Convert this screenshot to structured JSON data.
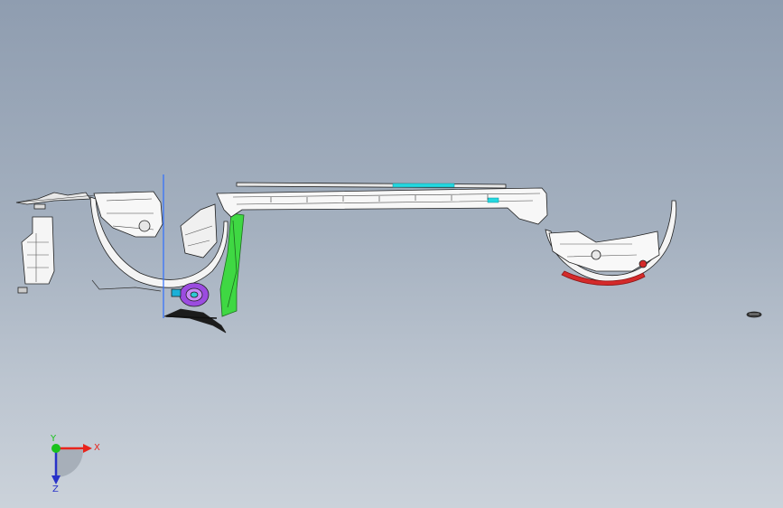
{
  "triad": {
    "x_label": "X",
    "y_label": "Y",
    "z_label": "Z",
    "x_color": "#e8241c",
    "y_color": "#19c21c",
    "z_color": "#2832c8"
  },
  "model": {
    "icon": "car-body-underbody-assembly",
    "accent_colors": {
      "cyan_trim": "#24d8e0",
      "green_pillar": "#35d23a",
      "purple_hub": "#8a3ccf",
      "red_liner": "#d42a2a",
      "blue_guide": "#2f6fff"
    }
  }
}
